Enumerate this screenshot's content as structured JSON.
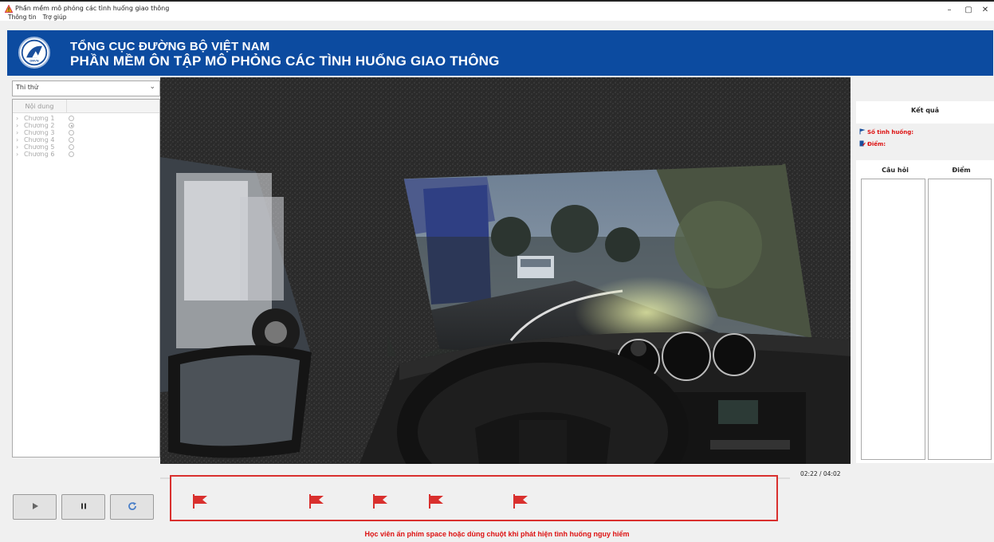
{
  "window": {
    "title": "Phần mềm mô phỏng các tình huống giao thông",
    "minimize": "–",
    "maximize": "▢",
    "close": "✕"
  },
  "menu": [
    "Thông tin",
    "Trợ giúp"
  ],
  "banner": {
    "line1": "TỔNG CỤC ĐƯỜNG BỘ VIỆT NAM",
    "line2": "PHẦN MỀM ÔN TẬP MÔ PHỎNG CÁC TÌNH HUỐNG GIAO THÔNG",
    "logo_text": "DRVN"
  },
  "left_panel": {
    "mode": "Thi thử",
    "tree_header": "Nội dung",
    "chapters": [
      {
        "label": "Chương 1",
        "selected": false
      },
      {
        "label": "Chương 2",
        "selected": true
      },
      {
        "label": "Chương 3",
        "selected": false
      },
      {
        "label": "Chương 4",
        "selected": false
      },
      {
        "label": "Chương 5",
        "selected": false
      },
      {
        "label": "Chương 6",
        "selected": false
      }
    ]
  },
  "results": {
    "title": "Kết quả",
    "situations_label": "Số tình huống:",
    "score_label": "Điểm:",
    "col_question": "Câu hỏi",
    "col_score": "Điểm"
  },
  "player": {
    "time": "02:22 / 04:02",
    "progress": 0.58,
    "play_icon": "play-icon",
    "pause_icon": "pause-icon",
    "reload_icon": "reload-icon"
  },
  "flags": {
    "count": 5,
    "icon": "flag-icon",
    "color": "#d9302e"
  },
  "instruction": "Học viên ấn phím space hoặc dùng chuột khi phát hiện tình huống nguy hiểm",
  "colors": {
    "banner": "#0c4ba0",
    "accent_red": "#d11",
    "playhead": "#2a74d8"
  }
}
